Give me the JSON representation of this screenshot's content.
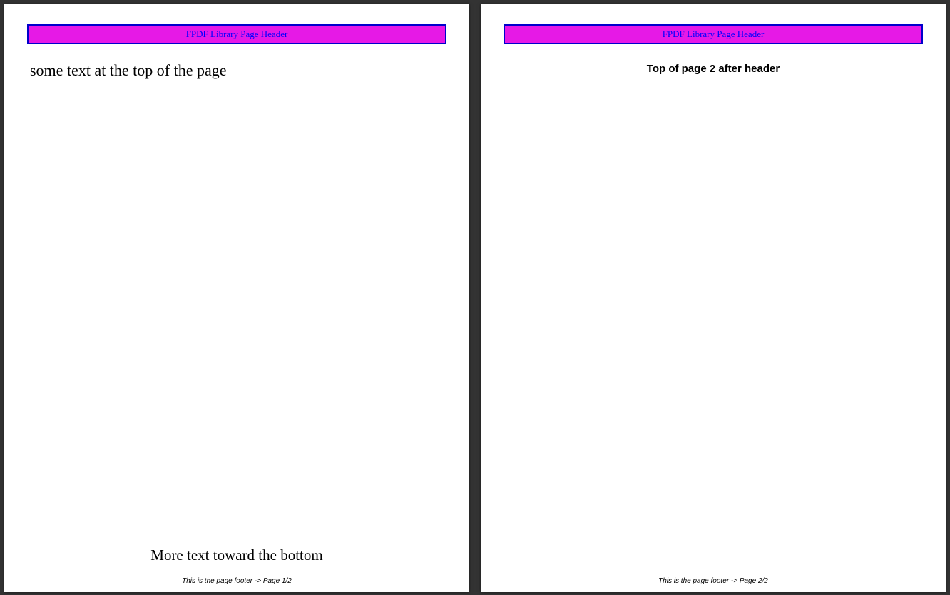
{
  "header": {
    "text": "FPDF Library Page Header"
  },
  "page1": {
    "top_text": "some text at the top of the page",
    "bottom_text": "More text toward the bottom",
    "footer": "This is the page footer -> Page 1/2"
  },
  "page2": {
    "top_text": "Top of page 2 after header",
    "footer": "This is the page footer -> Page 2/2"
  },
  "colors": {
    "header_fill": "#e619e6",
    "header_border": "#0000cc",
    "header_text": "#0000ff",
    "page_bg": "#ffffff",
    "viewer_bg": "#333333"
  },
  "total_pages": 2
}
